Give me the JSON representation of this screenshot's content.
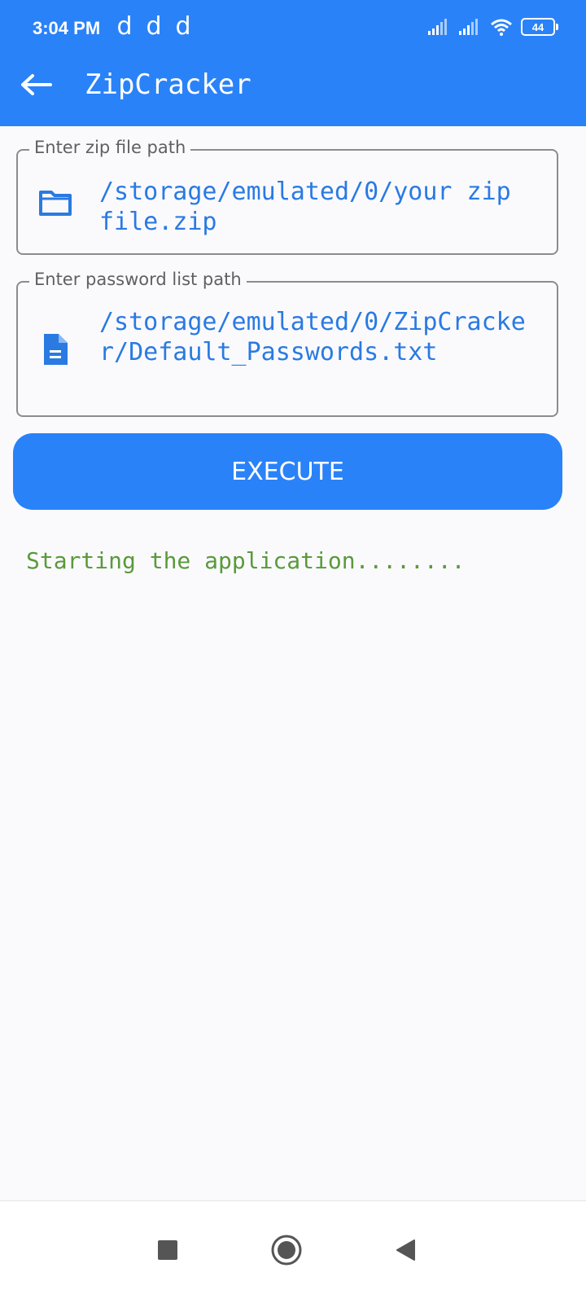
{
  "status_bar": {
    "time": "3:04 PM",
    "notifications": [
      "d",
      "d",
      "d"
    ],
    "battery": "44",
    "icons": [
      "signal-icon",
      "signal-icon",
      "wifi-icon",
      "battery-icon"
    ]
  },
  "app_bar": {
    "title": "ZipCracker",
    "back_icon": "arrow-left-icon"
  },
  "zip_field": {
    "label": "Enter zip file path",
    "value": "/storage/emulated/0/your zip file.zip",
    "icon": "folder-icon"
  },
  "password_field": {
    "label": "Enter password list path",
    "value": "/storage/emulated/0/ZipCracker/Default_Passwords.txt",
    "icon": "document-icon"
  },
  "execute_button": {
    "label": "EXECUTE"
  },
  "log": {
    "text": "Starting the application........"
  },
  "nav_bar": {
    "buttons": [
      "recents-square-icon",
      "home-circle-icon",
      "back-triangle-icon"
    ]
  },
  "colors": {
    "primary": "#2a82f8",
    "field_text": "#2a7ae2",
    "log_text": "#5a9a3a",
    "background": "#fafafd"
  }
}
